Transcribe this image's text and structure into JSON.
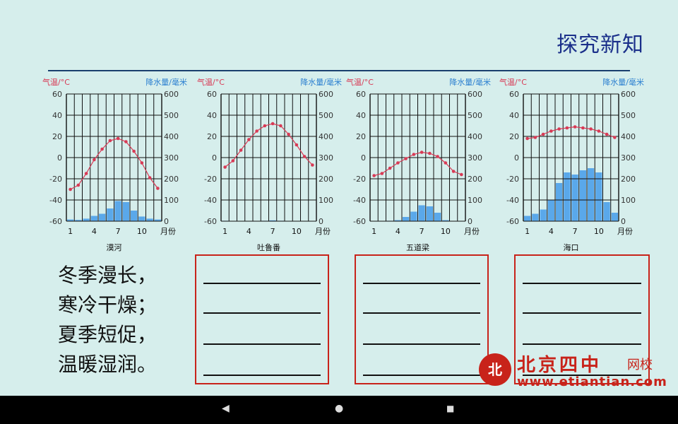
{
  "page": {
    "title": "探究新知"
  },
  "axis_labels": {
    "temp": "气温/°C",
    "precip": "降水量/毫米",
    "month_unit": "月份"
  },
  "chart_data": [
    {
      "type": "bar",
      "name": "漠河",
      "x": [
        1,
        2,
        3,
        4,
        5,
        6,
        7,
        8,
        9,
        10,
        11,
        12
      ],
      "temperature": [
        -30,
        -26,
        -15,
        -2,
        8,
        16,
        18,
        15,
        6,
        -5,
        -19,
        -29
      ],
      "precipitation": [
        8,
        6,
        12,
        25,
        35,
        60,
        95,
        90,
        50,
        22,
        12,
        8
      ],
      "temp_ylim": [
        -60,
        60
      ],
      "precip_ylim": [
        0,
        600
      ],
      "temp_ticks": [
        60,
        40,
        20,
        0,
        -20,
        -40,
        -60
      ],
      "precip_ticks": [
        600,
        500,
        400,
        300,
        200,
        100,
        0
      ],
      "x_ticks": [
        "1",
        "4",
        "7",
        "10"
      ]
    },
    {
      "type": "bar",
      "name": "吐鲁番",
      "x": [
        1,
        2,
        3,
        4,
        5,
        6,
        7,
        8,
        9,
        10,
        11,
        12
      ],
      "temperature": [
        -9,
        -3,
        7,
        17,
        25,
        30,
        32,
        30,
        22,
        12,
        1,
        -7
      ],
      "precipitation": [
        2,
        0,
        1,
        0,
        0,
        2,
        4,
        2,
        1,
        0,
        1,
        1
      ],
      "temp_ylim": [
        -60,
        60
      ],
      "precip_ylim": [
        0,
        600
      ],
      "temp_ticks": [
        60,
        40,
        20,
        0,
        -20,
        -40,
        -60
      ],
      "precip_ticks": [
        600,
        500,
        400,
        300,
        200,
        100,
        0
      ],
      "x_ticks": [
        "1",
        "4",
        "7",
        "10"
      ]
    },
    {
      "type": "bar",
      "name": "五道梁",
      "x": [
        1,
        2,
        3,
        4,
        5,
        6,
        7,
        8,
        9,
        10,
        11,
        12
      ],
      "temperature": [
        -17,
        -15,
        -10,
        -5,
        -1,
        3,
        5,
        4,
        1,
        -5,
        -13,
        -16
      ],
      "precipitation": [
        1,
        1,
        2,
        5,
        20,
        45,
        75,
        70,
        40,
        5,
        1,
        1
      ],
      "temp_ylim": [
        -60,
        60
      ],
      "precip_ylim": [
        0,
        600
      ],
      "temp_ticks": [
        60,
        40,
        20,
        0,
        -20,
        -40,
        -60
      ],
      "precip_ticks": [
        600,
        500,
        400,
        300,
        200,
        100,
        0
      ],
      "x_ticks": [
        "1",
        "4",
        "7",
        "10"
      ]
    },
    {
      "type": "bar",
      "name": "海口",
      "x": [
        1,
        2,
        3,
        4,
        5,
        6,
        7,
        8,
        9,
        10,
        11,
        12
      ],
      "temperature": [
        18,
        19,
        22,
        25,
        27,
        28,
        29,
        28,
        27,
        25,
        22,
        19
      ],
      "precipitation": [
        25,
        35,
        55,
        100,
        180,
        230,
        220,
        240,
        250,
        230,
        90,
        40
      ],
      "temp_ylim": [
        -60,
        60
      ],
      "precip_ylim": [
        0,
        600
      ],
      "temp_ticks": [
        60,
        40,
        20,
        0,
        -20,
        -40,
        -60
      ],
      "precip_ticks": [
        600,
        500,
        400,
        300,
        200,
        100,
        0
      ],
      "x_ticks": [
        "1",
        "4",
        "7",
        "10"
      ]
    }
  ],
  "summary": [
    "冬季漫长，",
    "寒冷干燥；",
    "夏季短促，",
    "温暖湿润。"
  ],
  "logo": {
    "seal": "北",
    "brand": "北京四中",
    "brand2": "网校",
    "url": "www.etiantian.com"
  },
  "colors": {
    "temp_line": "#d83a55",
    "precip_bar": "#5aa8ea",
    "grid": "#111111",
    "box_border": "#c8231a"
  },
  "nav": {
    "back": "◀",
    "home": "●",
    "recent": "■"
  }
}
